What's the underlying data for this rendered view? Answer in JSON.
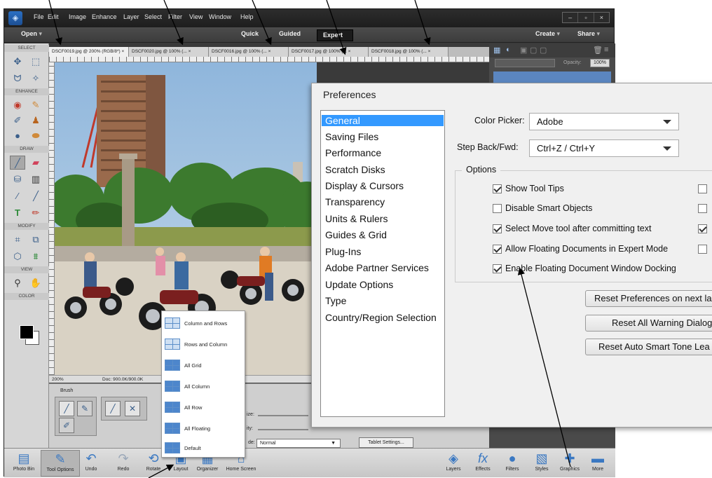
{
  "app": {
    "menu": [
      "File",
      "Edit",
      "Image",
      "Enhance",
      "Layer",
      "Select",
      "Filter",
      "View",
      "Window",
      "Help"
    ],
    "open_label": "Open",
    "modes": {
      "quick": "Quick",
      "guided": "Guided",
      "expert": "Expert"
    },
    "create_label": "Create",
    "share_label": "Share"
  },
  "toolbox": {
    "sections": {
      "select": "SELECT",
      "enhance": "ENHANCE",
      "draw": "DRAW",
      "modify": "MODIFY",
      "view": "VIEW",
      "color": "COLOR"
    },
    "icons": [
      "move-tool-icon",
      "marquee-tool-icon",
      "lasso-tool-icon",
      "magic-wand-icon",
      "red-eye-icon",
      "spot-healing-icon",
      "smart-brush-icon",
      "clone-stamp-icon",
      "blur-icon",
      "sponge-icon",
      "brush-icon",
      "eraser-icon",
      "paint-bucket-icon",
      "gradient-icon",
      "eyedropper-icon",
      "line-icon",
      "type-icon",
      "pencil-icon",
      "crop-icon",
      "recompose-icon",
      "content-aware-move-icon",
      "straighten-icon",
      "zoom-icon",
      "hand-icon"
    ],
    "foreground_color": "#000000",
    "background_color": "#ffffff"
  },
  "documents": {
    "tabs": [
      "DSCF0019.jpg @ 200% (RGB/8*)",
      "DSCF0020.jpg @ 100% (...",
      "DSCF0016.jpg @ 100% (...",
      "DSCF0017.jpg @ 100% (...",
      "DSCF0018.jpg @ 100% (..."
    ],
    "close_glyph": "×",
    "zoom": "200%",
    "doc_info": "Doc: 900.0K/900.0K"
  },
  "tool_options": {
    "brush_label": "Brush",
    "size_label": "ize:",
    "opacity_label": "ity:",
    "mode_label": "de:",
    "mode_value": "Normal",
    "tablet_settings": "Tablet Settings..."
  },
  "layers_panel": {
    "opacity_label": "Opacity:",
    "opacity_value": "100%"
  },
  "layout_menu": {
    "items": [
      "Column and Rows",
      "Rows and Column",
      "All Grid",
      "All Column",
      "All Row",
      "All Floating",
      "Default"
    ]
  },
  "taskbar": {
    "left": [
      "Photo Bin",
      "Tool Options",
      "Undo",
      "Redo",
      "Rotate",
      "Layout",
      "Organizer",
      "Home Screen"
    ],
    "right": [
      "Layers",
      "Effects",
      "Filters",
      "Styles",
      "Graphics",
      "More"
    ]
  },
  "preferences": {
    "title": "Preferences",
    "categories": [
      "General",
      "Saving Files",
      "Performance",
      "Scratch Disks",
      "Display & Cursors",
      "Transparency",
      "Units & Rulers",
      "Guides & Grid",
      "Plug-Ins",
      "Adobe Partner Services",
      "Update Options",
      "Type",
      "Country/Region Selection"
    ],
    "selected_category": "General",
    "color_picker_label": "Color Picker:",
    "color_picker_value": "Adobe",
    "step_label": "Step Back/Fwd:",
    "step_value": "Ctrl+Z / Ctrl+Y",
    "options_label": "Options",
    "options": [
      {
        "label": "Show Tool Tips",
        "checked": true
      },
      {
        "label": "Disable Smart Objects",
        "checked": false
      },
      {
        "label": "Select Move tool after committing text",
        "checked": true
      },
      {
        "label": "Allow Floating Documents in Expert Mode",
        "checked": true
      },
      {
        "label": "Enable Floating Document Window Docking",
        "checked": true
      }
    ],
    "right_column_checks": [
      false,
      false,
      true,
      false
    ],
    "buttons": [
      "Reset Preferences on next la",
      "Reset All Warning Dialog",
      "Reset Auto Smart Tone Lea"
    ]
  }
}
